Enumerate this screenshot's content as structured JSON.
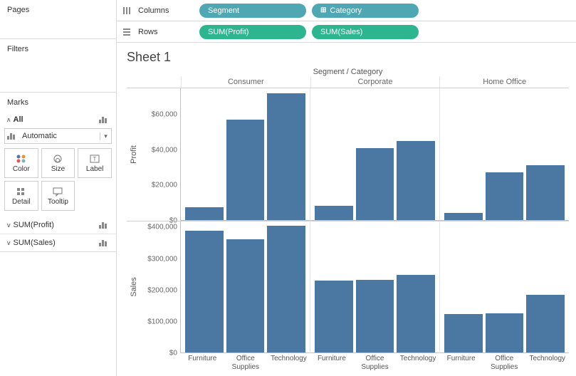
{
  "side": {
    "pages_title": "Pages",
    "filters_title": "Filters",
    "marks_title": "Marks",
    "all_label": "All",
    "marktype": "Automatic",
    "cards": [
      "Color",
      "Size",
      "Label",
      "Detail",
      "Tooltip"
    ],
    "measure1": "SUM(Profit)",
    "measure2": "SUM(Sales)"
  },
  "shelves": {
    "columns_label": "Columns",
    "rows_label": "Rows",
    "col_pills": [
      "Segment",
      "Category"
    ],
    "row_pills": [
      "SUM(Profit)",
      "SUM(Sales)"
    ]
  },
  "sheet": {
    "title": "Sheet 1",
    "supertitle": "Segment / Category",
    "segments": [
      "Consumer",
      "Corporate",
      "Home Office"
    ],
    "categories": [
      "Furniture",
      "Office Supplies",
      "Technology"
    ],
    "profit_label": "Profit",
    "sales_label": "Sales",
    "profit_ticks": [
      "$60,000",
      "$40,000",
      "$20,000",
      "$0"
    ],
    "sales_ticks": [
      "$400,000",
      "$300,000",
      "$200,000",
      "$100,000",
      "$0"
    ]
  },
  "chart_data": [
    {
      "type": "bar",
      "title": "Profit by Segment / Category",
      "ylabel": "Profit",
      "ylim": [
        0,
        75000
      ],
      "categories": [
        "Furniture",
        "Office Supplies",
        "Technology"
      ],
      "series": [
        {
          "name": "Consumer",
          "values": [
            7000,
            57000,
            72000
          ]
        },
        {
          "name": "Corporate",
          "values": [
            8000,
            41000,
            45000
          ]
        },
        {
          "name": "Home Office",
          "values": [
            4000,
            27000,
            31000
          ]
        }
      ]
    },
    {
      "type": "bar",
      "title": "Sales by Segment / Category",
      "ylabel": "Sales",
      "ylim": [
        0,
        420000
      ],
      "categories": [
        "Furniture",
        "Office Supplies",
        "Technology"
      ],
      "series": [
        {
          "name": "Consumer",
          "values": [
            390000,
            362000,
            405000
          ]
        },
        {
          "name": "Corporate",
          "values": [
            230000,
            232000,
            248000
          ]
        },
        {
          "name": "Home Office",
          "values": [
            122000,
            125000,
            185000
          ]
        }
      ]
    }
  ]
}
